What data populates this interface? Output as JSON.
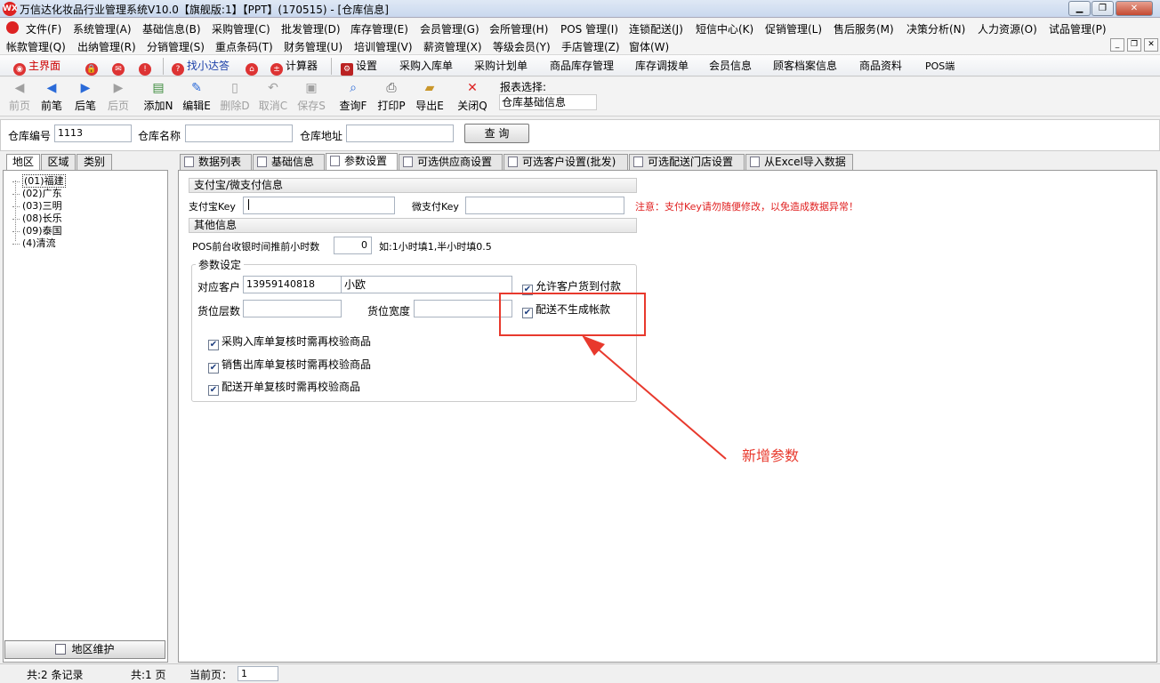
{
  "window": {
    "title": "万信达化妆品行业管理系统V10.0【旗舰版:1】【PPT】(170515) - [仓库信息]",
    "logo_text": "WX"
  },
  "menu_row1": [
    "文件(F)",
    "系统管理(A)",
    "基础信息(B)",
    "采购管理(C)",
    "批发管理(D)",
    "库存管理(E)",
    "会员管理(G)",
    "会所管理(H)",
    "POS 管理(I)",
    "连锁配送(J)",
    "短信中心(K)",
    "促销管理(L)",
    "售后服务(M)",
    "决策分析(N)",
    "人力资源(O)",
    "试品管理(P)"
  ],
  "menu_row2": [
    "帐款管理(Q)",
    "出纳管理(R)",
    "分销管理(S)",
    "重点条码(T)",
    "财务管理(U)",
    "培训管理(V)",
    "薪资管理(X)",
    "等级会员(Y)",
    "手店管理(Z)",
    "窗体(W)"
  ],
  "quickbar": {
    "home": "主界面",
    "assistant": "找小达答",
    "calculator": "计算器",
    "settings": "设置",
    "purchase_in": "采购入库单",
    "purchase_plan": "采购计划单",
    "stock_mgmt": "商品库存管理",
    "transfer": "库存调拨单",
    "member_info": "会员信息",
    "customer_archive": "顾客档案信息",
    "product_info": "商品资料",
    "pos": "POS端"
  },
  "toolbar": {
    "first": "前页",
    "prev": "前笔",
    "next": "后笔",
    "last": "后页",
    "add": "添加N",
    "edit": "编辑E",
    "delete": "删除D",
    "cancel": "取消C",
    "save": "保存S",
    "query": "查询F",
    "print": "打印P",
    "export": "导出E",
    "close": "关闭Q",
    "report_label": "报表选择:",
    "report_value": "仓库基础信息"
  },
  "search": {
    "code_label": "仓库编号",
    "code_value": "1113",
    "name_label": "仓库名称",
    "name_value": "",
    "addr_label": "仓库地址",
    "addr_value": "",
    "query_button": "查  询"
  },
  "left_tabs": [
    "地区",
    "区域",
    "类别"
  ],
  "tree": [
    {
      "label": "(01)福建"
    },
    {
      "label": "(02)广东"
    },
    {
      "label": "(03)三明"
    },
    {
      "label": "(08)长乐"
    },
    {
      "label": "(09)泰国"
    },
    {
      "label": "(4)清流"
    }
  ],
  "region_maint": "地区维护",
  "right_tabs": [
    "数据列表",
    "基础信息",
    "参数设置",
    "可选供应商设置",
    "可选客户设置(批发)",
    "可选配送门店设置",
    "从Excel导入数据"
  ],
  "payment": {
    "section": "支付宝/微支付信息",
    "alipay_label": "支付宝Key",
    "alipay_value": "",
    "wechat_label": "微支付Key",
    "wechat_value": "",
    "warning": "注意：支付Key请勿随便修改，以免造成数据异常！"
  },
  "other": {
    "section": "其他信息",
    "pos_hours_label": "POS前台收银时间推前小时数",
    "pos_hours_value": "0",
    "pos_hours_hint": "如:1小时填1,半小时填0.5"
  },
  "params": {
    "legend": "参数设定",
    "customer_label": "对应客户",
    "customer_code": "13959140818",
    "customer_name": "小欧",
    "allow_cod": "允许客户货到付款",
    "allow_cod_checked": true,
    "delivery_no_account": "配送不生成帐款",
    "delivery_no_account_checked": true,
    "layer_label": "货位层数",
    "layer_value": "",
    "width_label": "货位宽度",
    "width_value": "",
    "checks": [
      {
        "label": "采购入库单复核时需再校验商品",
        "checked": true
      },
      {
        "label": "销售出库单复核时需再校验商品",
        "checked": true
      },
      {
        "label": "配送开单复核时需再校验商品",
        "checked": true
      }
    ]
  },
  "annotation": {
    "text": "新增参数",
    "color": "#e8392d"
  },
  "status": {
    "records": "共:2 条记录",
    "pages": "共:1 页",
    "current_label": "当前页：",
    "current_value": "1"
  }
}
